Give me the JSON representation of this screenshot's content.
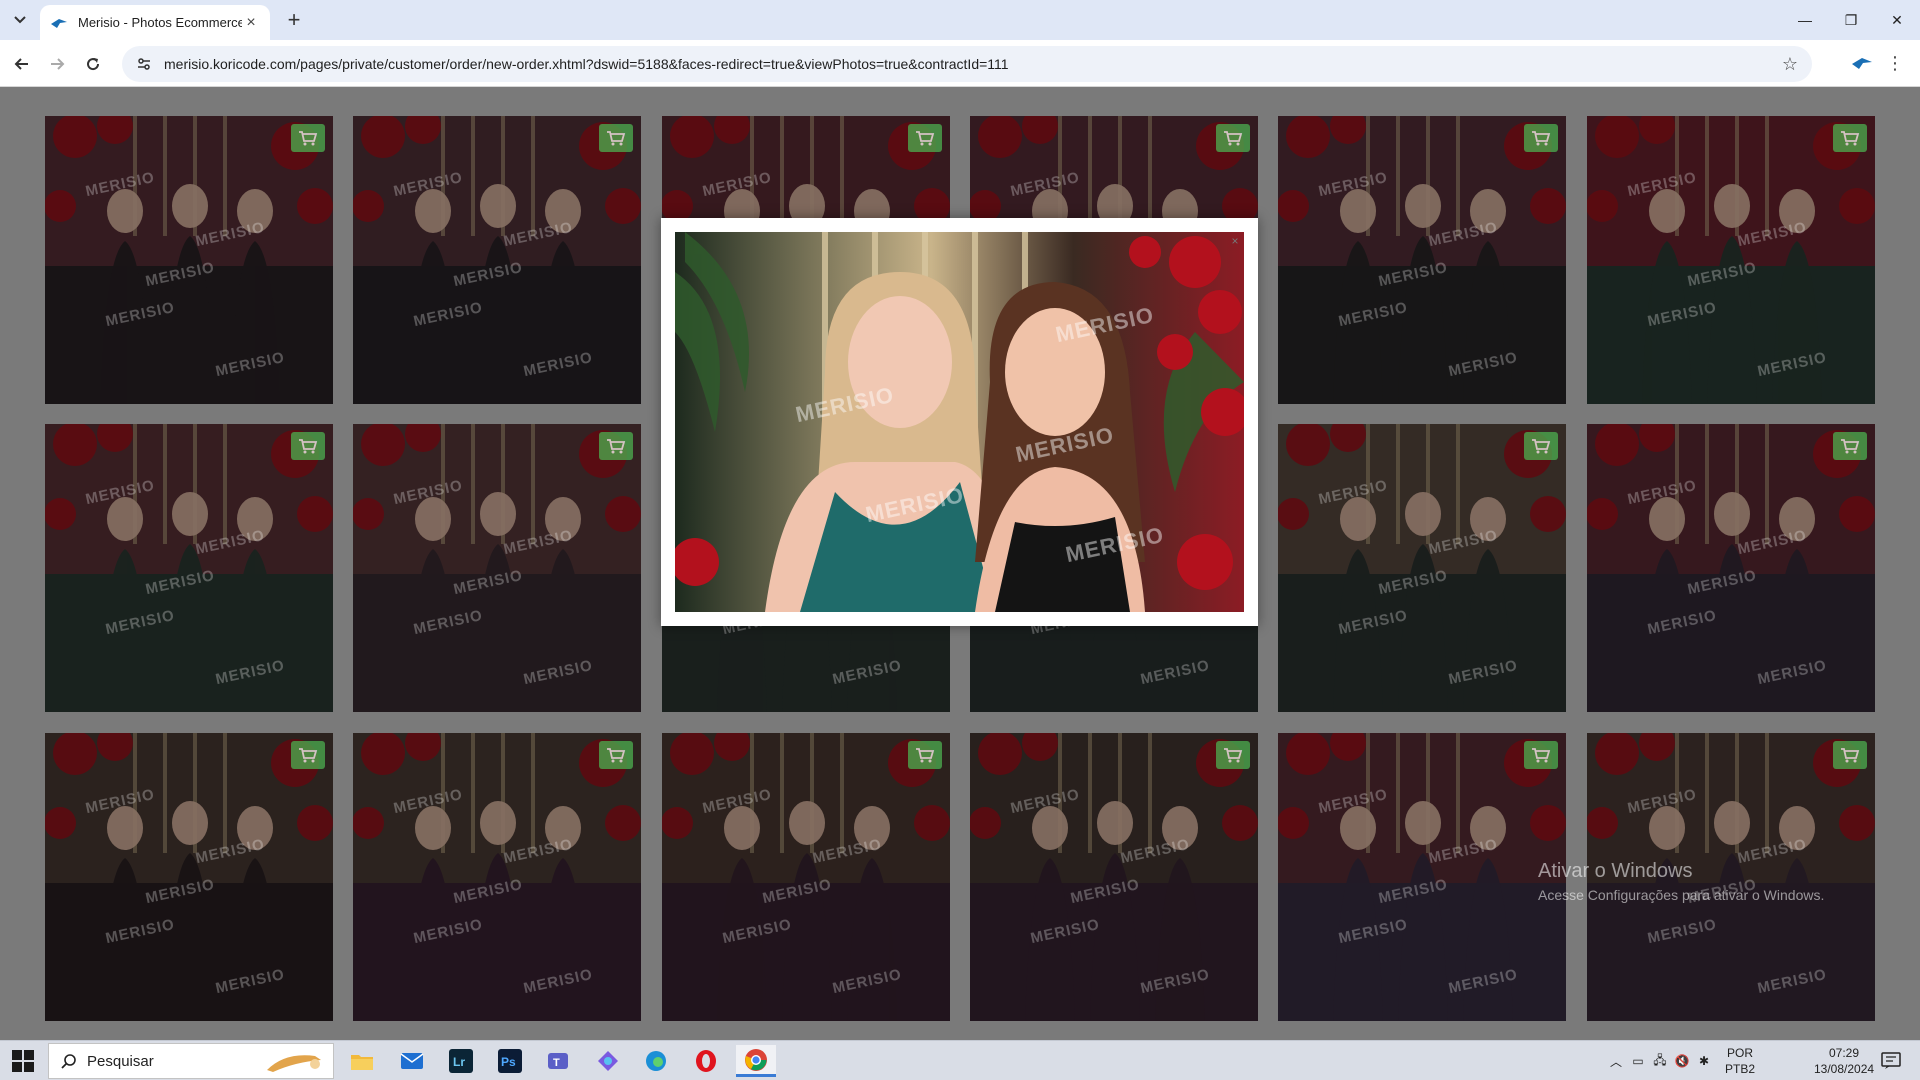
{
  "browser": {
    "tab_title": "Merisio - Photos Ecommerce",
    "new_tab_label": "+",
    "url": "merisio.koricode.com/pages/private/customer/order/new-order.xhtml?dswid=5188&faces-redirect=true&viewPhotos=true&contractId=111"
  },
  "gallery": {
    "watermark": "MERISIO",
    "photos": [
      {
        "scene": "group-formal",
        "c1": "#5a2f38",
        "c2": "#2a2326"
      },
      {
        "scene": "group-formal",
        "c1": "#54323a",
        "c2": "#292429"
      },
      {
        "scene": "group-formal",
        "c1": "#5c2b35",
        "c2": "#262226"
      },
      {
        "scene": "group-formal",
        "c1": "#582d37",
        "c2": "#272427"
      },
      {
        "scene": "group-formal",
        "c1": "#57303a",
        "c2": "#292628"
      },
      {
        "scene": "two-girls-green-pink",
        "c1": "#6b2430",
        "c2": "#2a3d36"
      },
      {
        "scene": "two-girls-green-pink",
        "c1": "#5e3338",
        "c2": "#2c3c35"
      },
      {
        "scene": "hug-green-pink",
        "c1": "#5b3a3c",
        "c2": "#3a2c33"
      },
      {
        "scene": "dresses-closeup",
        "c1": "#4b3a36",
        "c2": "#2b3631"
      },
      {
        "scene": "dresses-closeup",
        "c1": "#3c3a37",
        "c2": "#2a3331"
      },
      {
        "scene": "hug-green-black",
        "c1": "#5a4a40",
        "c2": "#2b3431"
      },
      {
        "scene": "three-people-purple",
        "c1": "#5e2a34",
        "c2": "#352a38"
      },
      {
        "scene": "three-faces",
        "c1": "#4a3b35",
        "c2": "#2a2024"
      },
      {
        "scene": "three-faces-pink",
        "c1": "#4d3d36",
        "c2": "#3c2335"
      },
      {
        "scene": "two-girls-black-pink",
        "c1": "#4c3a33",
        "c2": "#3a2432"
      },
      {
        "scene": "two-girls-black-pink",
        "c1": "#453732",
        "c2": "#3a2534"
      },
      {
        "scene": "family-floral",
        "c1": "#5a2d36",
        "c2": "#3a2f44"
      },
      {
        "scene": "family-closeup",
        "c1": "#4d3b36",
        "c2": "#3a2a3a"
      }
    ]
  },
  "modal": {
    "close_label": "×",
    "watermark": "MERISIO"
  },
  "os": {
    "activation_title": "Ativar o Windows",
    "activation_subtitle": "Acesse Configurações para ativar o Windows.",
    "search_placeholder": "Pesquisar",
    "lang_line1": "POR",
    "lang_line2": "PTB2",
    "time": "07:29",
    "date": "13/08/2024"
  },
  "colors": {
    "cart_green": "#4caf50",
    "accent_blue": "#3a7bd5",
    "dim_overlay": "#7a7a7a"
  },
  "icons": [
    "tab-list-icon",
    "favicon-icon",
    "close-icon",
    "back-icon",
    "forward-icon",
    "reload-icon",
    "site-info-icon",
    "star-icon",
    "profile-icon",
    "more-icon",
    "cart-icon",
    "windows-start-icon",
    "search-icon",
    "file-explorer-icon",
    "mail-icon",
    "lightroom-icon",
    "photoshop-icon",
    "teams-icon",
    "copilot-icon",
    "edge-icon",
    "opera-icon",
    "chrome-icon"
  ]
}
